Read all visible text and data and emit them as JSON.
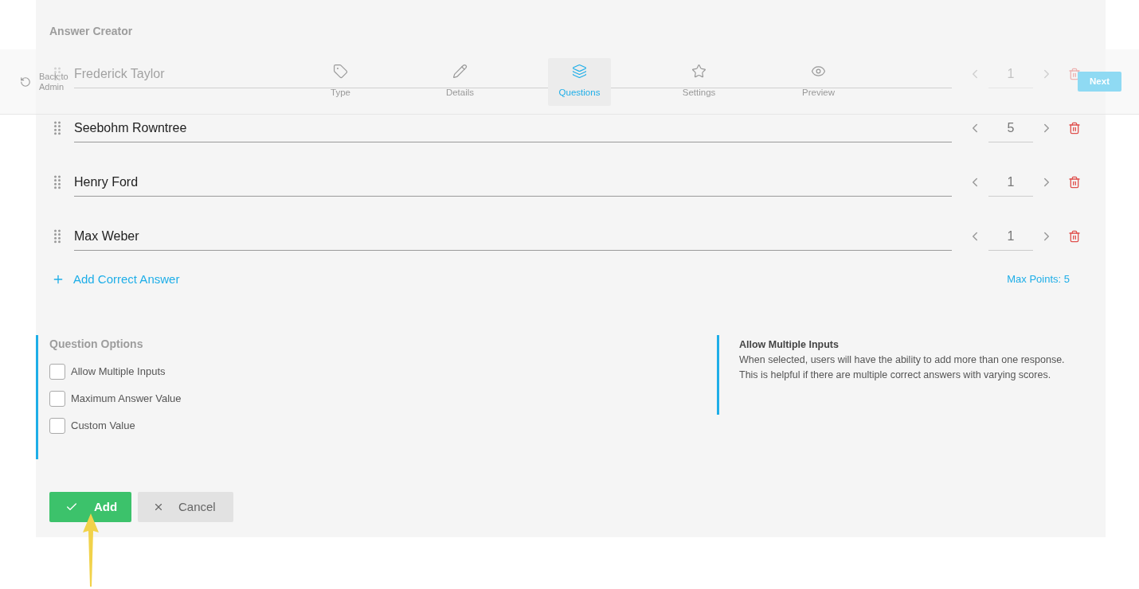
{
  "title": "Answer Creator",
  "answers": [
    {
      "text": "Frederick Taylor",
      "points": "1"
    },
    {
      "text": "Seebohm Rowntree",
      "points": "5"
    },
    {
      "text": "Henry Ford",
      "points": "1"
    },
    {
      "text": "Max Weber",
      "points": "1"
    }
  ],
  "add_answer": "Add Correct Answer",
  "max_points": "Max Points: 5",
  "options": {
    "title": "Question Options",
    "items": [
      {
        "label": "Allow Multiple Inputs",
        "checked": false
      },
      {
        "label": "Maximum Answer Value",
        "checked": false
      },
      {
        "label": "Custom Value",
        "checked": false
      }
    ]
  },
  "help": {
    "title": "Allow Multiple Inputs",
    "text": "When selected, users will have the ability to add more than one response. This is helpful if there are multiple correct answers with varying scores."
  },
  "buttons": [
    {
      "kind": "confirm",
      "label": "Add"
    },
    {
      "kind": "cancel",
      "label": "Cancel"
    }
  ],
  "nav": {
    "back": "Back to Admin",
    "tabs": [
      {
        "kind": "tag",
        "label": "Type",
        "selected": false
      },
      {
        "kind": "pencil",
        "label": "Details",
        "selected": false
      },
      {
        "kind": "layers",
        "label": "Questions",
        "selected": true
      },
      {
        "kind": "star",
        "label": "Settings",
        "selected": false
      },
      {
        "kind": "eye",
        "label": "Preview",
        "selected": false
      }
    ],
    "next": "Next"
  }
}
